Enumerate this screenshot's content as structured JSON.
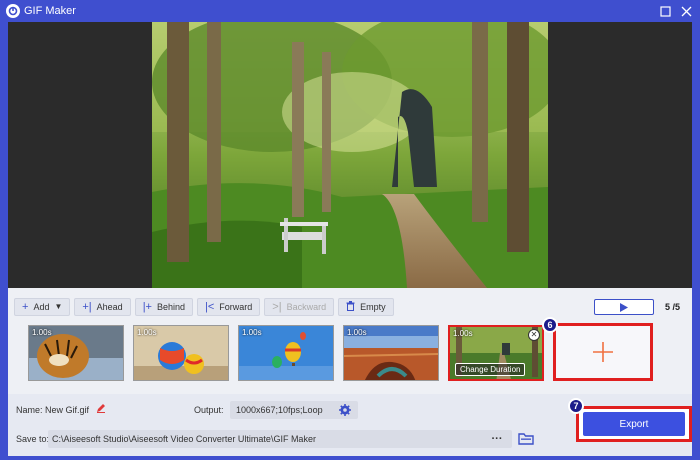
{
  "window": {
    "title": "GIF Maker"
  },
  "toolbar": {
    "add": "Add",
    "ahead": "Ahead",
    "behind": "Behind",
    "forward": "Forward",
    "backward": "Backward",
    "empty": "Empty"
  },
  "playback": {
    "frame_count": "5 /5"
  },
  "frames": [
    {
      "duration": "1.00s",
      "scene": "tiger"
    },
    {
      "duration": "1.00s",
      "scene": "balls"
    },
    {
      "duration": "1.00s",
      "scene": "balloons"
    },
    {
      "duration": "1.00s",
      "scene": "canyon"
    },
    {
      "duration": "1.00s",
      "scene": "forest-path",
      "selected": true,
      "action": "Change Duration"
    }
  ],
  "steps": {
    "add_frame": "6",
    "export": "7"
  },
  "settings": {
    "name_label": "Name:",
    "name_value": "New Gif.gif",
    "output_label": "Output:",
    "output_value": "1000x667;10fps;Loop",
    "save_label": "Save to:",
    "save_path": "C:\\Aiseesoft Studio\\Aiseesoft Video Converter Ultimate\\GIF Maker",
    "browse": "···"
  },
  "export": {
    "label": "Export"
  },
  "colors": {
    "accent": "#3c50e0",
    "highlight": "#e01f1f",
    "titlebar": "#3f4fcf"
  }
}
